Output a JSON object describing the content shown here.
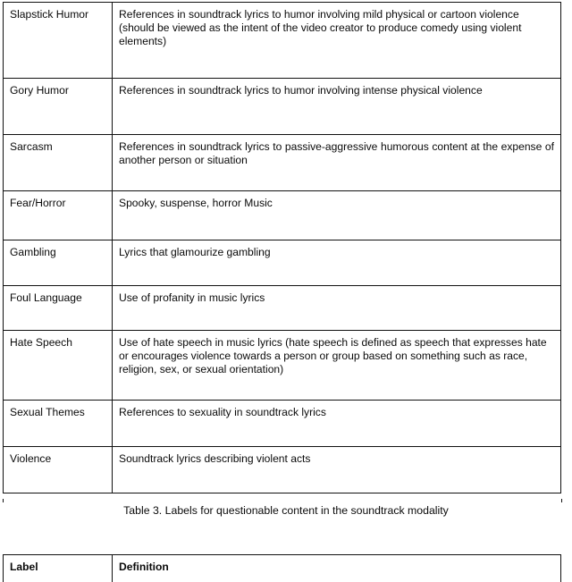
{
  "document": {
    "table3": {
      "caption": "Table 3. Labels for questionable content in the soundtrack modality",
      "rows": [
        {
          "label": "Slapstick Humor",
          "definition": "References in soundtrack lyrics to humor involving mild physical or cartoon violence (should be viewed as the intent of the video creator to produce comedy using violent elements)",
          "justified": false
        },
        {
          "label": "Gory Humor",
          "definition": "References in soundtrack lyrics to humor involving intense physical violence",
          "justified": false
        },
        {
          "label": "Sarcasm",
          "definition": "References in soundtrack lyrics to passive-aggressive humorous content at the expense of another person or situation",
          "justified": true
        },
        {
          "label": "Fear/Horror",
          "definition": "Spooky, suspense, horror Music",
          "justified": false
        },
        {
          "label": "Gambling",
          "definition": "Lyrics that glamourize gambling",
          "justified": false
        },
        {
          "label": "Foul Language",
          "definition": "Use of profanity in music lyrics",
          "justified": false
        },
        {
          "label": "Hate Speech",
          "definition": "Use of hate speech in music lyrics (hate speech is defined as speech that expresses hate or encourages violence towards a person or group based on something such as race, religion, sex, or sexual orientation)",
          "justified": false
        },
        {
          "label": "Sexual Themes",
          "definition": "References to sexuality in soundtrack lyrics",
          "justified": false
        },
        {
          "label": "Violence",
          "definition": "Soundtrack lyrics describing violent acts",
          "justified": false
        }
      ]
    },
    "table4": {
      "headers": {
        "label": "Label",
        "definition": "Definition"
      }
    }
  }
}
